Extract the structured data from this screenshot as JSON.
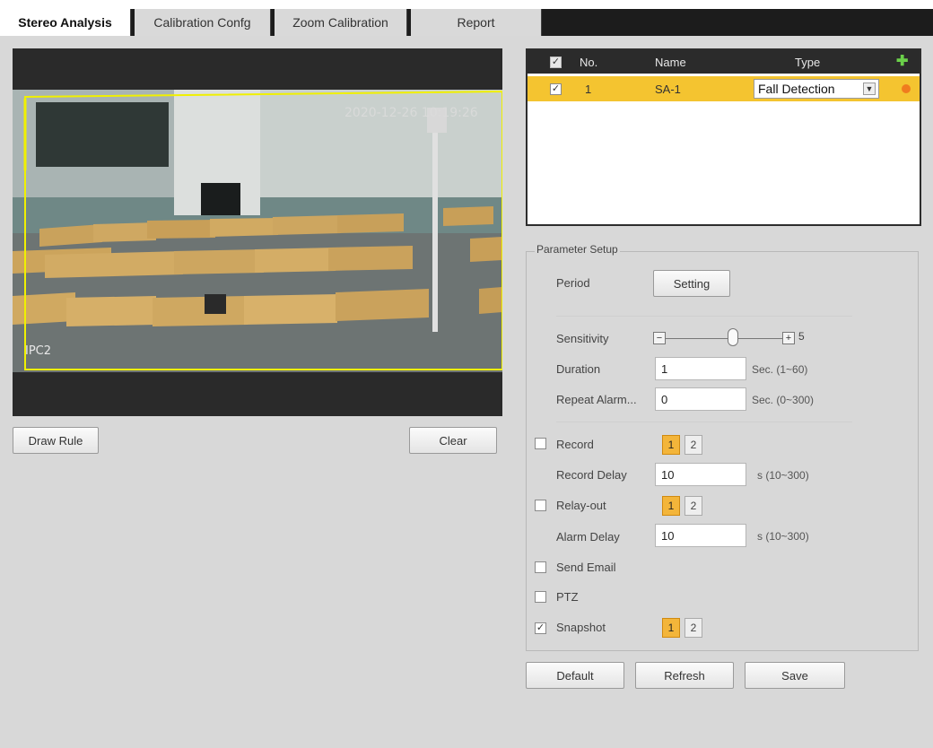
{
  "tabs": [
    {
      "label": "Stereo Analysis",
      "active": true
    },
    {
      "label": "Calibration Confg",
      "active": false
    },
    {
      "label": "Zoom Calibration",
      "active": false
    },
    {
      "label": "Report",
      "active": false
    }
  ],
  "video": {
    "timestamp": "2020-12-26 10:19:26",
    "channel_name": "IPC2"
  },
  "video_buttons": {
    "draw_rule": "Draw Rule",
    "clear": "Clear"
  },
  "rules_table": {
    "header": {
      "no": "No.",
      "name": "Name",
      "type": "Type"
    },
    "rows": [
      {
        "checked": true,
        "no": "1",
        "name": "SA-1",
        "type": "Fall Detection"
      }
    ]
  },
  "parameter_setup": {
    "legend": "Parameter Setup",
    "period_label": "Period",
    "setting_button": "Setting",
    "sensitivity_label": "Sensitivity",
    "sensitivity_minus": "−",
    "sensitivity_plus": "+",
    "sensitivity_value": "5",
    "duration_label": "Duration",
    "duration_value": "1",
    "duration_hint": "Sec. (1~60)",
    "repeat_label": "Repeat Alarm...",
    "repeat_value": "0",
    "repeat_hint": "Sec. (0~300)",
    "record_label": "Record",
    "record_checked": false,
    "record_delay_label": "Record Delay",
    "record_delay_value": "10",
    "record_delay_hint": "s (10~300)",
    "relay_label": "Relay-out",
    "relay_checked": false,
    "alarm_delay_label": "Alarm Delay",
    "alarm_delay_value": "10",
    "alarm_delay_hint": "s (10~300)",
    "send_email_label": "Send Email",
    "send_email_checked": false,
    "ptz_label": "PTZ",
    "ptz_checked": false,
    "snapshot_label": "Snapshot",
    "snapshot_checked": true,
    "channel_1": "1",
    "channel_2": "2"
  },
  "footer_buttons": {
    "default": "Default",
    "refresh": "Refresh",
    "save": "Save"
  },
  "colors": {
    "selected_row": "#f4c430",
    "channel_on": "#f3b53a",
    "rule_line": "#f0f000",
    "add_icon": "#6bd04a",
    "delete_icon": "#f07c1e"
  }
}
